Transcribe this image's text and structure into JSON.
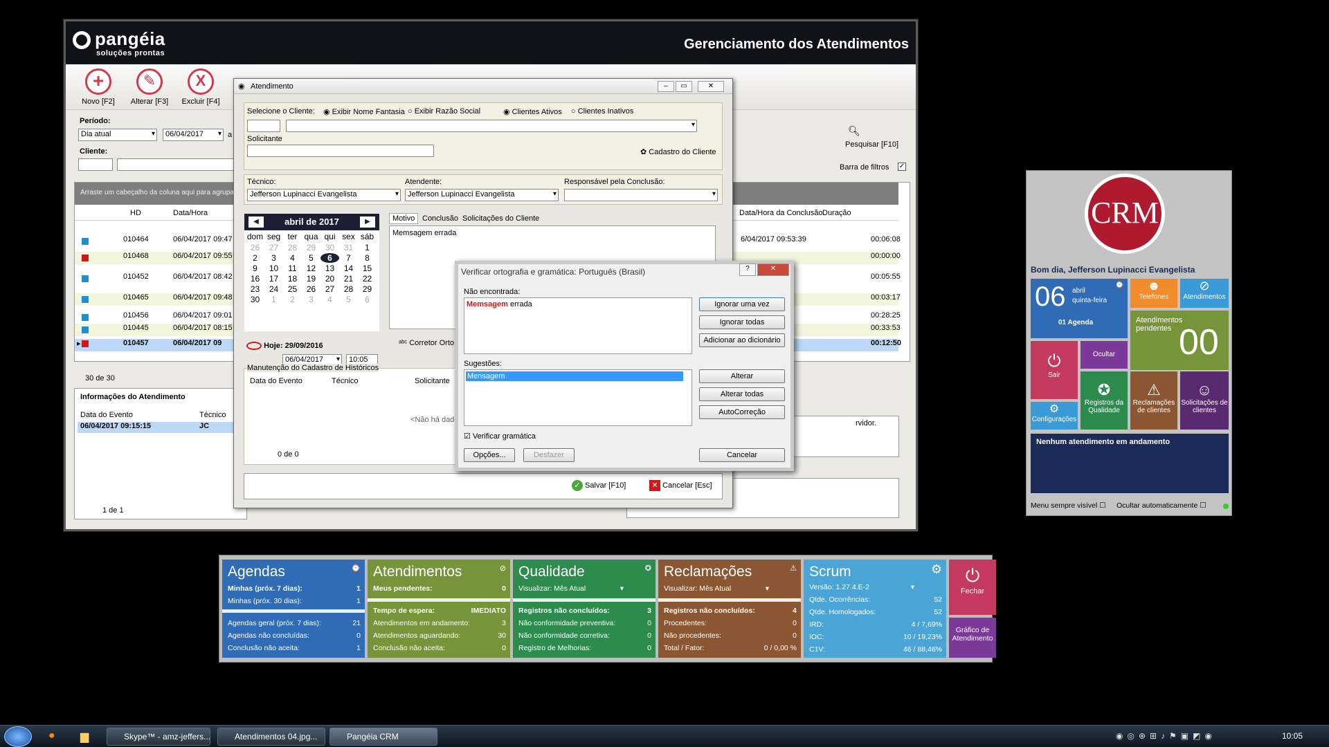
{
  "main": {
    "logo_name": "pangéia",
    "logo_sub": "soluções prontas",
    "title": "Gerenciamento dos Atendimentos",
    "toolbar": [
      {
        "label": "Novo [F2]",
        "icon": "plus-icon",
        "glyph": "+"
      },
      {
        "label": "Alterar [F3]",
        "icon": "pencil-icon",
        "glyph": "✎"
      },
      {
        "label": "Excluir [F4]",
        "icon": "x-icon",
        "glyph": "X"
      }
    ],
    "periodo_label": "Período:",
    "periodo_value": "Dia atual",
    "date_from": "06/04/2017",
    "a_label": "a",
    "cliente_label": "Cliente:",
    "pesquisar": "Pesquisar [F10]",
    "barra_filtros": "Barra de filtros",
    "group_hint": "Arraste um cabeçalho da coluna aqui para agrupar",
    "columns": {
      "hd": "HD",
      "datahora": "Data/Hora",
      "conclusao": "Data/Hora da Conclusão",
      "duracao": "Duração"
    },
    "rows": [
      {
        "hd": "010464",
        "dt": "06/04/2017 09:47",
        "concl": "6/04/2017 09:53:39",
        "dur": "00:06:08",
        "color": "blue"
      },
      {
        "hd": "010468",
        "dt": "06/04/2017 09:55",
        "concl": "",
        "dur": "00:00:00",
        "color": "red"
      },
      {
        "hd": "010452",
        "dt": "06/04/2017 08:42",
        "concl": "",
        "dur": "00:05:55",
        "color": "blue"
      },
      {
        "hd": "010465",
        "dt": "06/04/2017 09:48",
        "concl": "",
        "dur": "00:03:17",
        "color": "blue"
      },
      {
        "hd": "010456",
        "dt": "06/04/2017 09:01",
        "concl": "",
        "dur": "00:28:25",
        "color": "blue"
      },
      {
        "hd": "010445",
        "dt": "06/04/2017 08:15",
        "concl": "",
        "dur": "00:33:53",
        "color": "blue"
      },
      {
        "hd": "010457",
        "dt": "06/04/2017 09",
        "concl": "",
        "dur": "00:12:50",
        "color": "red"
      }
    ],
    "pager": "30 de 30",
    "info_title": "Informações do Atendimento",
    "info_cols": {
      "data": "Data do Evento",
      "tecnico": "Técnico"
    },
    "info_row": {
      "data": "06/04/2017 09:15:15",
      "tecnico": "JC"
    },
    "info_pager": "1 de 1",
    "right_text": "rvidor."
  },
  "dlg": {
    "title": "Atendimento",
    "sel_cliente": "Selecione o Cliente:",
    "opt_fantasia": "Exibir Nome Fantasia",
    "opt_razao": "Exibir Razão Social",
    "opt_ativos": "Clientes Ativos",
    "opt_inativos": "Clientes Inativos",
    "solicitante": "Solicitante",
    "cadastro": "Cadastro do Cliente",
    "tecnico_label": "Técnico:",
    "tecnico_value": "Jefferson Lupinacci Evangelista",
    "atendente_label": "Atendente:",
    "atendente_value": "Jefferson Lupinacci Evangelista",
    "resp_label": "Responsável pela Conclusão:",
    "cal_month": "abril de 2017",
    "weekdays": [
      "dom",
      "seg",
      "ter",
      "qua",
      "qui",
      "sex",
      "sáb"
    ],
    "hoje": "Hoje: 29/09/2016",
    "date_value": "06/04/2017",
    "time_value": "10:05",
    "tabs": [
      "Motivo",
      "Conclusão",
      "Solicitações do Cliente"
    ],
    "motivo_text": "Memsagem errada",
    "corretor": "Corretor Orto",
    "manut": "Manutenção do Cadastro de Históricos",
    "manut_cols": {
      "data": "Data do Evento",
      "tecnico": "Técnico",
      "solic": "Solicitante"
    },
    "nodata": "<Não há dados",
    "manut_pager": "0 de 0",
    "salvar": "Salvar [F10]",
    "cancelar": "Cancelar [Esc]"
  },
  "spell": {
    "title": "Verificar ortografia e gramática: Português (Brasil)",
    "nao_encontrada": "Não encontrada:",
    "bad_word": "Memsagem",
    "rest": " errada",
    "sugestoes": "Sugestões:",
    "suggestion": "Mensagem",
    "ignorar_uma": "Ignorar uma vez",
    "ignorar_todas": "Ignorar todas",
    "adicionar": "Adicionar ao dicionário",
    "alterar": "Alterar",
    "alterar_todas": "Alterar todas",
    "autocorrecao": "AutoCorreção",
    "verificar_gramatica": "Verificar gramática",
    "opcoes": "Opções...",
    "desfazer": "Desfazer",
    "cancelar": "Cancelar"
  },
  "crm": {
    "greeting": "Bom dia, Jefferson Lupinacci Evangelista",
    "day": "06",
    "month": "abril",
    "weekday": "quinta-feira",
    "agenda": "01 Agenda",
    "telefones": "Telefones",
    "atendimentos": "Atendimentos",
    "pendentes_label": "Atendimentos pendentes",
    "pendentes_value": "00",
    "sair": "Sair",
    "ocultar": "Ocultar",
    "configuracoes": "Configurações",
    "registros": "Registros da Qualidade",
    "reclamacoes": "Reclamações de clientes",
    "solicitacoes": "Solicitações de clientes",
    "nenhum": "Nenhum atendimento em andamento",
    "menu_visivel": "Menu sempre visível",
    "ocultar_auto": "Ocultar automaticamente"
  },
  "dash": {
    "agendas": {
      "title": "Agendas",
      "l1": "Minhas (próx. 7 dias):",
      "v1": "1",
      "l2": "Minhas (próx. 30 dias):",
      "v2": "1",
      "l3": "Agendas geral (próx. 7 dias):",
      "v3": "21",
      "l4": "Agendas não concluídas:",
      "v4": "0",
      "l5": "Conclusão não aceita:",
      "v5": "1"
    },
    "atend": {
      "title": "Atendimentos",
      "l1": "Meus pendentes:",
      "v1": "0",
      "l2": "Tempo de espera:",
      "v2": "IMEDIATO",
      "l3": "Atendimentos em andamento:",
      "v3": "3",
      "l4": "Atendimentos aguardando:",
      "v4": "30",
      "l5": "Conclusão não aceita:",
      "v5": "0"
    },
    "qual": {
      "title": "Qualidade",
      "sel": "Visualizar: Mês Atual",
      "l1": "Registros não concluídos:",
      "v1": "3",
      "l2": "Não conformidade preventiva:",
      "v2": "0",
      "l3": "Não conformidade corretiva:",
      "v3": "0",
      "l4": "Registro de Melhorias:",
      "v4": "0"
    },
    "recl": {
      "title": "Reclamações",
      "sel": "Visualizar: Mês Atual",
      "l1": "Registros não concluídos:",
      "v1": "4",
      "l2": "Procedentes:",
      "v2": "0",
      "l3": "Não procedentes:",
      "v3": "0",
      "l4": "Total / Fator:",
      "v4": "0 / 0,00 %"
    },
    "scrum": {
      "title": "Scrum",
      "sel": "Versão: 1.27.4.E-2",
      "l1": "Qtde. Ocorrências:",
      "v1": "52",
      "l2": "Qtde. Homologados:",
      "v2": "52",
      "l3": "IRD:",
      "v3": "4 / 7,69%",
      "l4": "IOC:",
      "v4": "10 / 19,23%",
      "l5": "C1V:",
      "v5": "46 / 88,46%"
    },
    "fechar": "Fechar",
    "grafico": "Gráfico de Atendimento"
  },
  "taskbar": {
    "tasks": [
      "Skype™ - amz-jeffers...",
      "Atendimentos 04.jpg...",
      "Pangéia CRM"
    ],
    "clock": "10:05"
  },
  "colors": {
    "agendas": "#2f6cb5",
    "atend": "#76953a",
    "qual": "#2e8b4e",
    "recl": "#8a5732",
    "scrum": "#4aa4d6",
    "fechar": "#c43a5e",
    "grafico": "#7b3a9a",
    "accent_red": "#d13a4a"
  }
}
